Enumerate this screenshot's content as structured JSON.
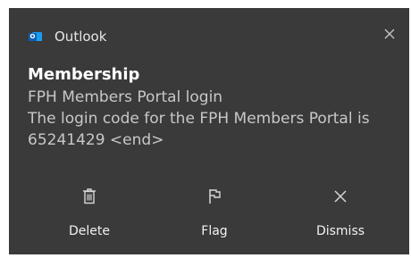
{
  "header": {
    "app_name": "Outlook",
    "app_icon": "outlook-icon",
    "close_icon": "close-icon"
  },
  "message": {
    "title": "Membership",
    "lines": [
      "FPH Members Portal login",
      "The login code for the FPH Members Portal is",
      "65241429 <end>"
    ]
  },
  "actions": [
    {
      "label": "Delete",
      "icon": "trash-icon"
    },
    {
      "label": "Flag",
      "icon": "flag-icon"
    },
    {
      "label": "Dismiss",
      "icon": "close-icon"
    }
  ],
  "colors": {
    "background": "#3a3a3a",
    "outlook_blue": "#1a9bf0"
  }
}
